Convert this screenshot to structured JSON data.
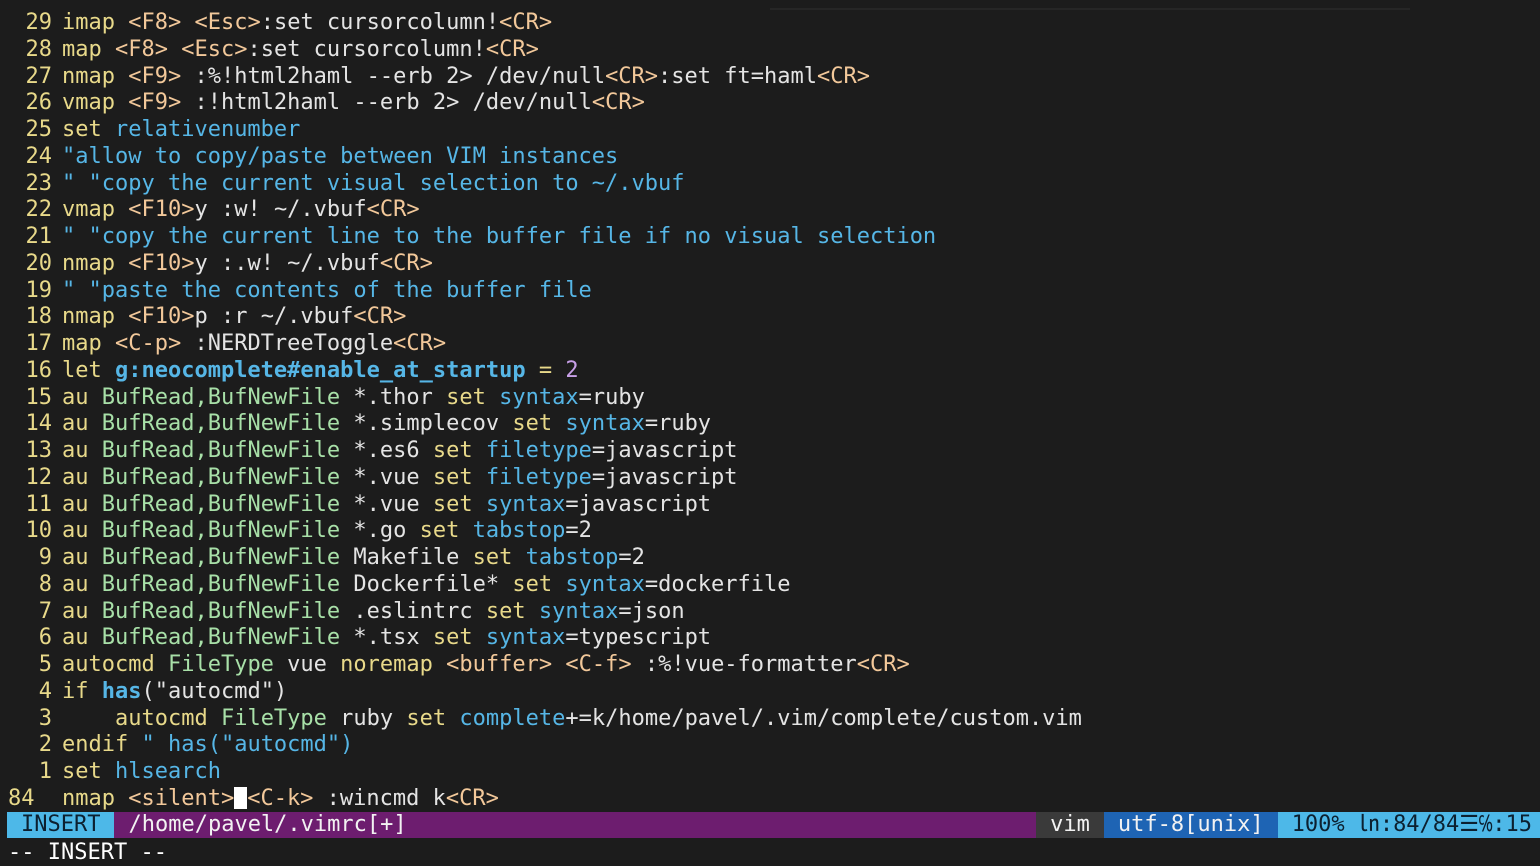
{
  "editor": {
    "lines": [
      {
        "num": "29",
        "tokens": [
          {
            "t": "imap ",
            "c": "keyword"
          },
          {
            "t": "<F8>",
            "c": "key"
          },
          {
            "t": " ",
            "c": "plain"
          },
          {
            "t": "<Esc>",
            "c": "key"
          },
          {
            "t": ":set cursorcolumn!",
            "c": "plain"
          },
          {
            "t": "<CR>",
            "c": "key"
          }
        ]
      },
      {
        "num": "28",
        "tokens": [
          {
            "t": "map ",
            "c": "keyword"
          },
          {
            "t": "<F8>",
            "c": "key"
          },
          {
            "t": " ",
            "c": "plain"
          },
          {
            "t": "<Esc>",
            "c": "key"
          },
          {
            "t": ":set cursorcolumn!",
            "c": "plain"
          },
          {
            "t": "<CR>",
            "c": "key"
          }
        ]
      },
      {
        "num": "27",
        "tokens": [
          {
            "t": "nmap ",
            "c": "keyword"
          },
          {
            "t": "<F9>",
            "c": "key"
          },
          {
            "t": " :%!html2haml --erb 2> /dev/null",
            "c": "plain"
          },
          {
            "t": "<CR>",
            "c": "key"
          },
          {
            "t": ":set ft=haml",
            "c": "plain"
          },
          {
            "t": "<CR>",
            "c": "key"
          }
        ]
      },
      {
        "num": "26",
        "tokens": [
          {
            "t": "vmap ",
            "c": "keyword"
          },
          {
            "t": "<F9>",
            "c": "key"
          },
          {
            "t": " :!html2haml --erb 2> /dev/null",
            "c": "plain"
          },
          {
            "t": "<CR>",
            "c": "key"
          }
        ]
      },
      {
        "num": "25",
        "tokens": [
          {
            "t": "set ",
            "c": "keyword"
          },
          {
            "t": "relativenumber",
            "c": "option"
          }
        ]
      },
      {
        "num": "24",
        "tokens": [
          {
            "t": "\"allow to copy/paste between VIM instances",
            "c": "comment"
          }
        ]
      },
      {
        "num": "23",
        "tokens": [
          {
            "t": "\" \"copy the current visual selection to ~/.vbuf",
            "c": "comment"
          }
        ]
      },
      {
        "num": "22",
        "tokens": [
          {
            "t": "vmap ",
            "c": "keyword"
          },
          {
            "t": "<F10>",
            "c": "key"
          },
          {
            "t": "y :w! ~/.vbuf",
            "c": "plain"
          },
          {
            "t": "<CR>",
            "c": "key"
          }
        ]
      },
      {
        "num": "21",
        "tokens": [
          {
            "t": "\" \"copy the current line to the buffer file if no visual selection",
            "c": "comment"
          }
        ]
      },
      {
        "num": "20",
        "tokens": [
          {
            "t": "nmap ",
            "c": "keyword"
          },
          {
            "t": "<F10>",
            "c": "key"
          },
          {
            "t": "y :.w! ~/.vbuf",
            "c": "plain"
          },
          {
            "t": "<CR>",
            "c": "key"
          }
        ]
      },
      {
        "num": "19",
        "tokens": [
          {
            "t": "\" \"paste the contents of the buffer file",
            "c": "comment"
          }
        ]
      },
      {
        "num": "18",
        "tokens": [
          {
            "t": "nmap ",
            "c": "keyword"
          },
          {
            "t": "<F10>",
            "c": "key"
          },
          {
            "t": "p :r ~/.vbuf",
            "c": "plain"
          },
          {
            "t": "<CR>",
            "c": "key"
          }
        ]
      },
      {
        "num": "17",
        "tokens": [
          {
            "t": "map ",
            "c": "keyword"
          },
          {
            "t": "<C-p>",
            "c": "key"
          },
          {
            "t": " :NERDTreeToggle",
            "c": "plain"
          },
          {
            "t": "<CR>",
            "c": "key"
          }
        ]
      },
      {
        "num": "16",
        "tokens": [
          {
            "t": "let ",
            "c": "keyword"
          },
          {
            "t": "g:neocomplete#enable_at_startup",
            "c": "func"
          },
          {
            "t": " = ",
            "c": "keyword"
          },
          {
            "t": "2",
            "c": "number"
          }
        ]
      },
      {
        "num": "15",
        "tokens": [
          {
            "t": "au ",
            "c": "keyword"
          },
          {
            "t": "BufRead,BufNewFile",
            "c": "event"
          },
          {
            "t": " *.thor ",
            "c": "plain"
          },
          {
            "t": "set ",
            "c": "keyword"
          },
          {
            "t": "syntax",
            "c": "option"
          },
          {
            "t": "=ruby",
            "c": "plain"
          }
        ]
      },
      {
        "num": "14",
        "tokens": [
          {
            "t": "au ",
            "c": "keyword"
          },
          {
            "t": "BufRead,BufNewFile",
            "c": "event"
          },
          {
            "t": " *.simplecov ",
            "c": "plain"
          },
          {
            "t": "set ",
            "c": "keyword"
          },
          {
            "t": "syntax",
            "c": "option"
          },
          {
            "t": "=ruby",
            "c": "plain"
          }
        ]
      },
      {
        "num": "13",
        "tokens": [
          {
            "t": "au ",
            "c": "keyword"
          },
          {
            "t": "BufRead,BufNewFile",
            "c": "event"
          },
          {
            "t": " *.es6 ",
            "c": "plain"
          },
          {
            "t": "set ",
            "c": "keyword"
          },
          {
            "t": "filetype",
            "c": "option"
          },
          {
            "t": "=javascript",
            "c": "plain"
          }
        ]
      },
      {
        "num": "12",
        "tokens": [
          {
            "t": "au ",
            "c": "keyword"
          },
          {
            "t": "BufRead,BufNewFile",
            "c": "event"
          },
          {
            "t": " *.vue ",
            "c": "plain"
          },
          {
            "t": "set ",
            "c": "keyword"
          },
          {
            "t": "filetype",
            "c": "option"
          },
          {
            "t": "=javascript",
            "c": "plain"
          }
        ]
      },
      {
        "num": "11",
        "tokens": [
          {
            "t": "au ",
            "c": "keyword"
          },
          {
            "t": "BufRead,BufNewFile",
            "c": "event"
          },
          {
            "t": " *.vue ",
            "c": "plain"
          },
          {
            "t": "set ",
            "c": "keyword"
          },
          {
            "t": "syntax",
            "c": "option"
          },
          {
            "t": "=javascript",
            "c": "plain"
          }
        ]
      },
      {
        "num": "10",
        "tokens": [
          {
            "t": "au ",
            "c": "keyword"
          },
          {
            "t": "BufRead,BufNewFile",
            "c": "event"
          },
          {
            "t": " *.go ",
            "c": "plain"
          },
          {
            "t": "set ",
            "c": "keyword"
          },
          {
            "t": "tabstop",
            "c": "option"
          },
          {
            "t": "=2",
            "c": "plain"
          }
        ]
      },
      {
        "num": "9",
        "tokens": [
          {
            "t": "au ",
            "c": "keyword"
          },
          {
            "t": "BufRead,BufNewFile",
            "c": "event"
          },
          {
            "t": " Makefile ",
            "c": "plain"
          },
          {
            "t": "set ",
            "c": "keyword"
          },
          {
            "t": "tabstop",
            "c": "option"
          },
          {
            "t": "=2",
            "c": "plain"
          }
        ]
      },
      {
        "num": "8",
        "tokens": [
          {
            "t": "au ",
            "c": "keyword"
          },
          {
            "t": "BufRead,BufNewFile",
            "c": "event"
          },
          {
            "t": " Dockerfile* ",
            "c": "plain"
          },
          {
            "t": "set ",
            "c": "keyword"
          },
          {
            "t": "syntax",
            "c": "option"
          },
          {
            "t": "=dockerfile",
            "c": "plain"
          }
        ]
      },
      {
        "num": "7",
        "tokens": [
          {
            "t": "au ",
            "c": "keyword"
          },
          {
            "t": "BufRead,BufNewFile",
            "c": "event"
          },
          {
            "t": " .eslintrc ",
            "c": "plain"
          },
          {
            "t": "set ",
            "c": "keyword"
          },
          {
            "t": "syntax",
            "c": "option"
          },
          {
            "t": "=json",
            "c": "plain"
          }
        ]
      },
      {
        "num": "6",
        "tokens": [
          {
            "t": "au ",
            "c": "keyword"
          },
          {
            "t": "BufRead,BufNewFile",
            "c": "event"
          },
          {
            "t": " *.tsx ",
            "c": "plain"
          },
          {
            "t": "set ",
            "c": "keyword"
          },
          {
            "t": "syntax",
            "c": "option"
          },
          {
            "t": "=typescript",
            "c": "plain"
          }
        ]
      },
      {
        "num": "5",
        "tokens": [
          {
            "t": "autocmd ",
            "c": "keyword"
          },
          {
            "t": "FileType",
            "c": "event"
          },
          {
            "t": " vue ",
            "c": "plain"
          },
          {
            "t": "noremap ",
            "c": "keyword"
          },
          {
            "t": "<buffer>",
            "c": "key"
          },
          {
            "t": " ",
            "c": "plain"
          },
          {
            "t": "<C-f>",
            "c": "key"
          },
          {
            "t": " :%!vue-formatter",
            "c": "plain"
          },
          {
            "t": "<CR>",
            "c": "key"
          }
        ]
      },
      {
        "num": "4",
        "tokens": [
          {
            "t": "if ",
            "c": "keyword"
          },
          {
            "t": "has",
            "c": "func"
          },
          {
            "t": "(\"autocmd\")",
            "c": "plain"
          }
        ]
      },
      {
        "num": "3",
        "tokens": [
          {
            "t": "    autocmd ",
            "c": "keyword"
          },
          {
            "t": "FileType",
            "c": "event"
          },
          {
            "t": " ruby ",
            "c": "plain"
          },
          {
            "t": "set ",
            "c": "keyword"
          },
          {
            "t": "complete",
            "c": "option"
          },
          {
            "t": "+=k/home/pavel/.vim/complete/custom.vim",
            "c": "plain"
          }
        ]
      },
      {
        "num": "2",
        "tokens": [
          {
            "t": "endif ",
            "c": "keyword"
          },
          {
            "t": "\" has(\"autocmd\")",
            "c": "comment"
          }
        ]
      },
      {
        "num": "1",
        "tokens": [
          {
            "t": "set ",
            "c": "keyword"
          },
          {
            "t": "hlsearch",
            "c": "option"
          }
        ]
      },
      {
        "num": "84",
        "current": true,
        "tokens": [
          {
            "t": "nmap ",
            "c": "keyword"
          },
          {
            "t": "<silent>",
            "c": "key"
          },
          {
            "t": "__CURSOR__",
            "c": "cursor"
          },
          {
            "t": "<C-k>",
            "c": "key"
          },
          {
            "t": " :wincmd k",
            "c": "plain"
          },
          {
            "t": "<CR>",
            "c": "key"
          }
        ]
      }
    ]
  },
  "statusline": {
    "mode": "INSERT",
    "file": "/home/pavel/.vimrc[+]",
    "filetype": "vim",
    "encoding": "utf-8[unix]",
    "position": "100% ㏑:84/84☰℅:15"
  },
  "cmdline": {
    "text": "-- INSERT --"
  },
  "colors": {
    "background": "#1c1c1c",
    "line_number": "#e8d98a",
    "keyword": "#e8d98a",
    "option": "#56b6e6",
    "key": "#f2c89a",
    "mode_bg": "#4db8e8",
    "file_bg": "#6d1d6f",
    "encoding_bg": "#1e64b4"
  }
}
